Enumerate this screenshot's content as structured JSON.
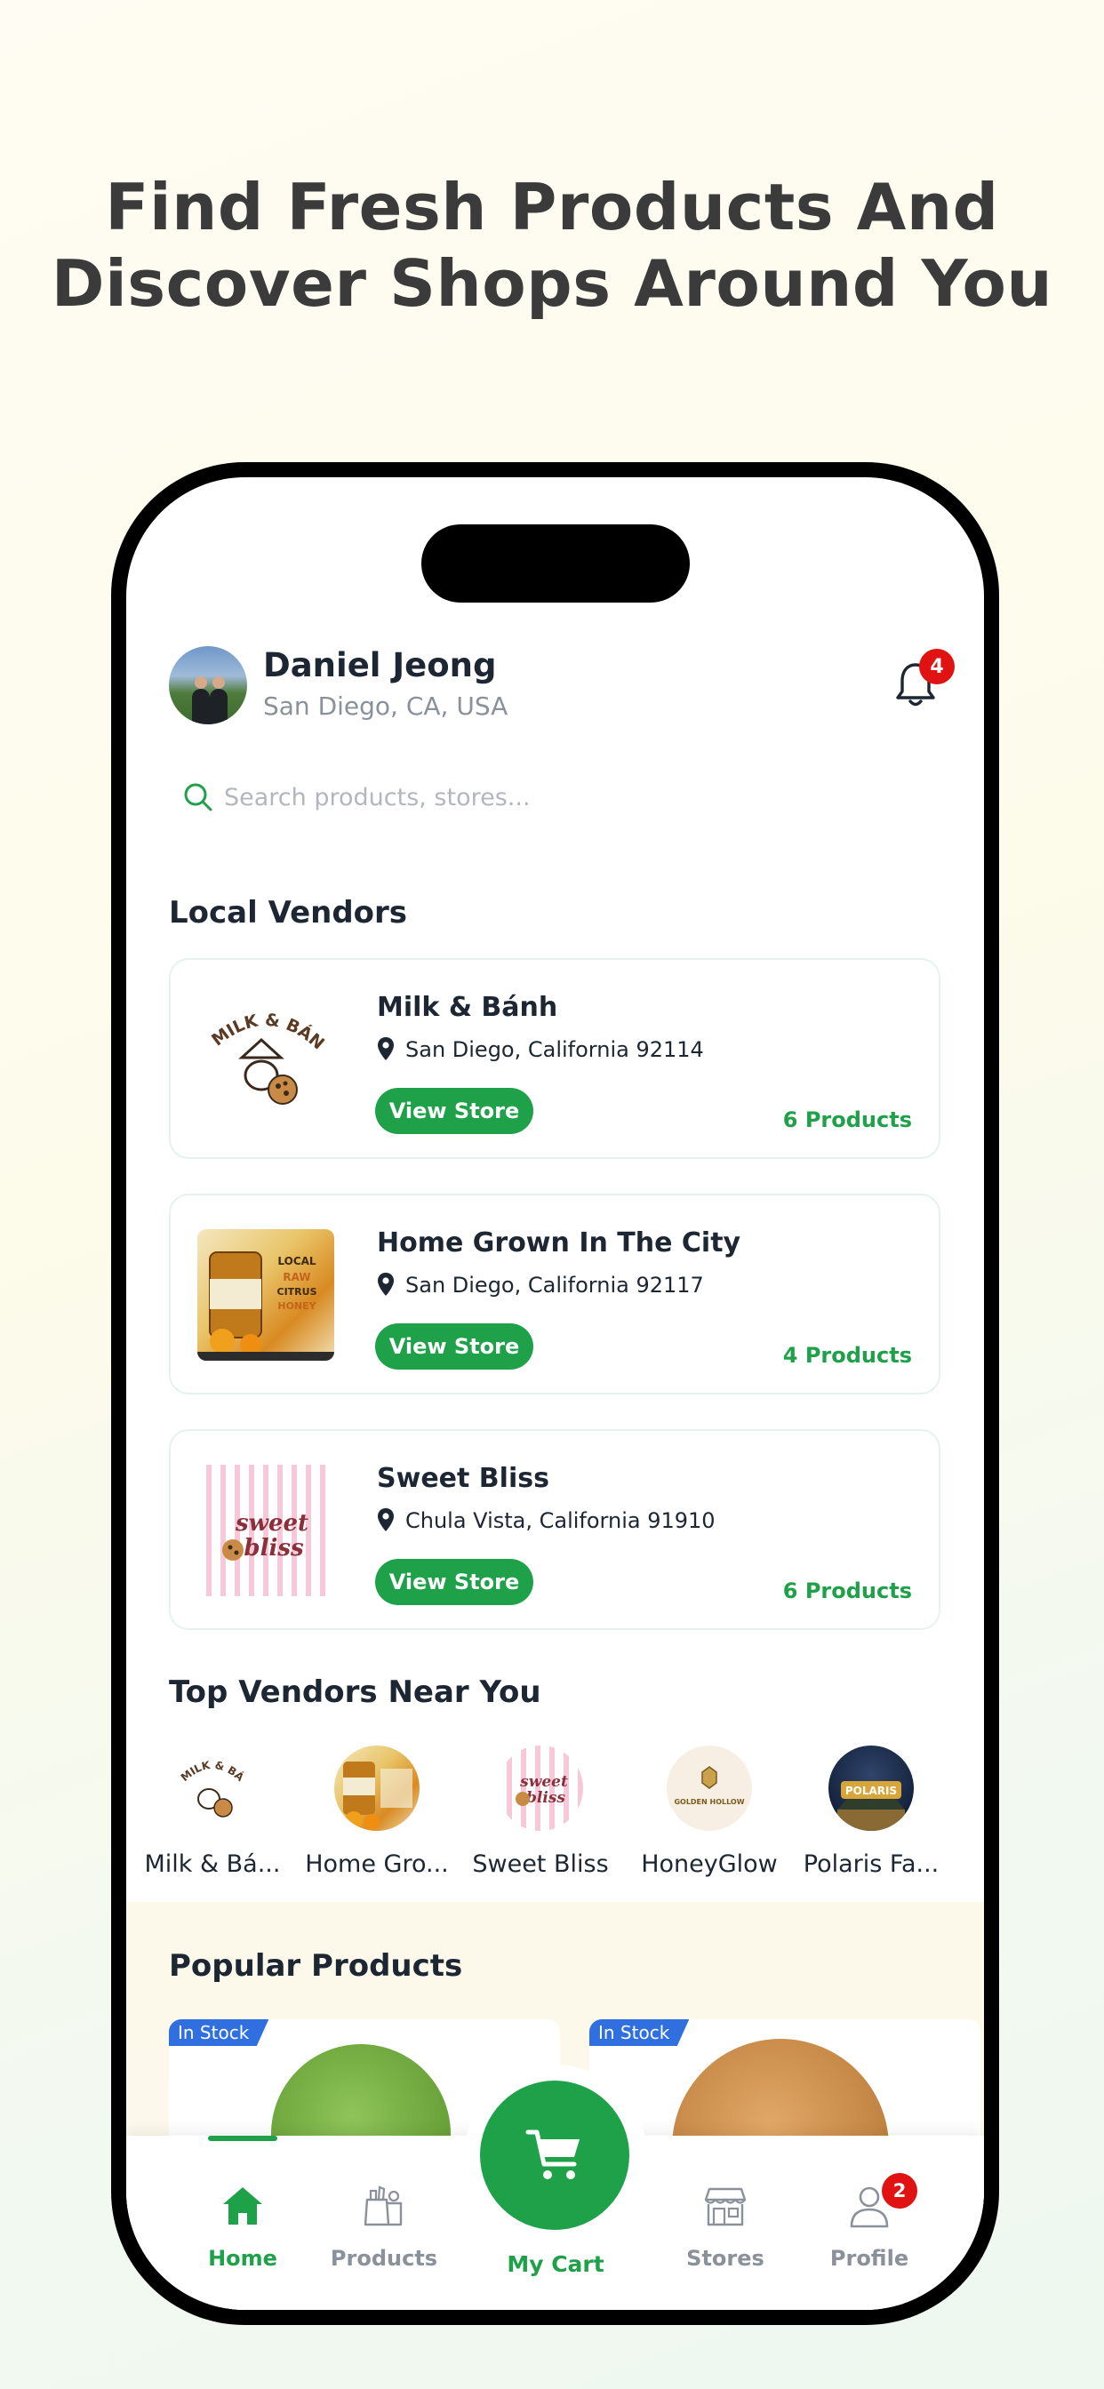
{
  "headline": {
    "line1": "Find Fresh Products And",
    "line2": "Discover Shops Around You"
  },
  "user": {
    "name": "Daniel Jeong",
    "location": "San Diego, CA, USA"
  },
  "notifications": {
    "count": "4"
  },
  "search": {
    "placeholder": "Search products, stores..."
  },
  "local_vendors": {
    "title": "Local Vendors",
    "items": [
      {
        "name": "Milk & Bánh",
        "address": "San Diego, California 92114",
        "button": "View Store",
        "count": "6 Products",
        "logo_text": "MILK & BÁNH"
      },
      {
        "name": "Home Grown In The City",
        "address": "San Diego, California 92117",
        "button": "View Store",
        "count": "4 Products",
        "logo_text": "LOCAL RAW CITRUS HONEY"
      },
      {
        "name": "Sweet Bliss",
        "address": "Chula Vista, California 91910",
        "button": "View Store",
        "count": "6 Products",
        "logo_text": "sweet bliss"
      }
    ]
  },
  "top_vendors": {
    "title": "Top Vendors Near You",
    "items": [
      {
        "label": "Milk & Bá..."
      },
      {
        "label": "Home Gro..."
      },
      {
        "label": "Sweet Bliss"
      },
      {
        "label": "HoneyGlow",
        "logo_text": "GOLDEN HOLLOW"
      },
      {
        "label": "Polaris Fa...",
        "logo_text": "POLARIS"
      }
    ]
  },
  "popular_products": {
    "title": "Popular Products",
    "items": [
      {
        "badge": "In Stock"
      },
      {
        "badge": "In Stock"
      }
    ]
  },
  "tabbar": {
    "home": "Home",
    "products": "Products",
    "cart": "My Cart",
    "stores": "Stores",
    "profile": "Profile",
    "profile_badge": "2"
  },
  "colors": {
    "accent": "#1fa14a",
    "badge": "#e01212",
    "instock": "#2f6fe0"
  }
}
